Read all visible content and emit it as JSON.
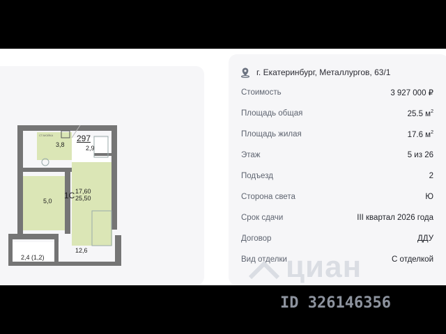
{
  "address": {
    "text": "г. Екатеринбург, Металлургов, 63/1",
    "icon": "location-pin-icon"
  },
  "details": [
    {
      "label": "Стоимость",
      "value": "3 927 000 ₽"
    },
    {
      "label": "Площадь общая",
      "value": "25.5 м",
      "unit_sup": "2"
    },
    {
      "label": "Площадь жилая",
      "value": "17.6 м",
      "unit_sup": "2"
    },
    {
      "label": "Этаж",
      "value": "5 из 26"
    },
    {
      "label": "Подъезд",
      "value": "2"
    },
    {
      "label": "Сторона света",
      "value": "Ю"
    },
    {
      "label": "Срок сдачи",
      "value": "III квартал 2026 года"
    },
    {
      "label": "Договор",
      "value": "ДДУ"
    },
    {
      "label": "Вид отделки",
      "value": "С отделкой"
    }
  ],
  "floorplan": {
    "apartment_number": "297",
    "rooms_count": "1С",
    "living_area": "17,60",
    "total_area": "25,50",
    "balcony_note": "2,4 (1,2)",
    "rooms": [
      {
        "area": "3,8"
      },
      {
        "area": "2,9"
      },
      {
        "area": "5,0"
      },
      {
        "area": "12,6"
      }
    ],
    "tiny_label": "СТ.МОЙКА"
  },
  "watermark": {
    "brand": "циан",
    "id": "ID 326146356"
  },
  "colors": {
    "background": "#000000",
    "card": "#f6f6f8",
    "plan_green": "#dbe6b6",
    "wall": "#757575"
  }
}
